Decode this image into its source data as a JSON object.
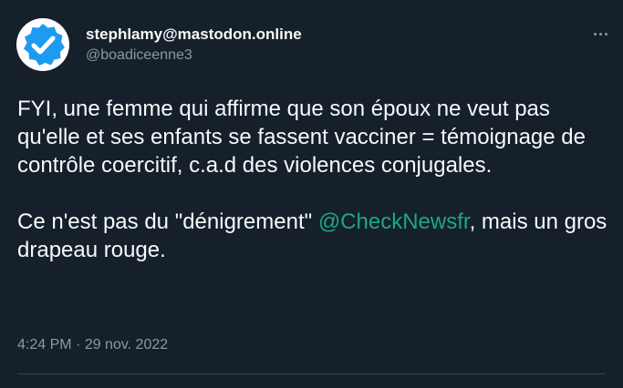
{
  "author": {
    "display_name": "stephlamy@mastodon.online",
    "handle": "@boadiceenne3",
    "avatar_icon": "verified-badge-icon"
  },
  "tweet": {
    "paragraph1": "FYI, une femme qui affirme que son époux ne veut pas qu'elle et ses enfants se fassent vacciner = témoignage de contrôle coercitif, c.a.d des violences conjugales.",
    "paragraph2_before": "Ce n'est pas du \"dénigrement\" ",
    "mention": "@CheckNewsfr",
    "paragraph2_after": ", mais un gros drapeau rouge."
  },
  "meta": {
    "time": "4:24 PM",
    "separator": " · ",
    "date": "29 nov. 2022"
  },
  "colors": {
    "background": "#15202b",
    "text": "#f7f9f9",
    "secondary": "#8b98a5",
    "mention": "#1ea58a",
    "badge": "#1d9bf0"
  }
}
